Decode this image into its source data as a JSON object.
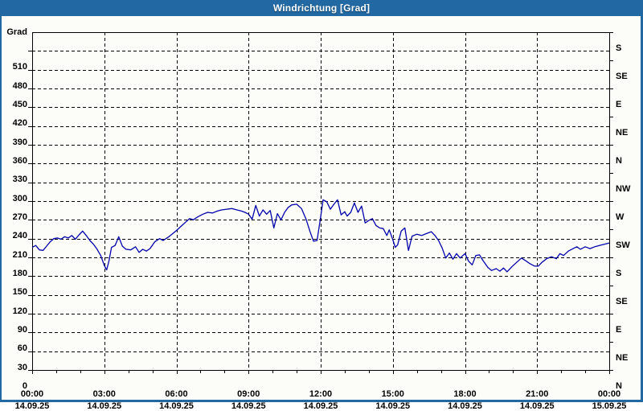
{
  "window": {
    "title": "Windrichtung [Grad]"
  },
  "colors": {
    "titlebar": "#2269a3",
    "window_border": "#2269a3",
    "title_text": "#ffffff",
    "plot_background": "#fcfcf8",
    "axis_color": "#000000",
    "grid_color": "#000000",
    "line_color": "#0000aa",
    "label_color": "#000000"
  },
  "chart_data": {
    "type": "line",
    "title": "Windrichtung [Grad]",
    "ylabel": "Grad",
    "xlabel": "",
    "ylim": [
      0,
      540
    ],
    "xlim_hours": [
      0,
      24
    ],
    "grid": "dashed",
    "legend_position": "none",
    "y_ticks": [
      0,
      30,
      60,
      90,
      120,
      150,
      180,
      210,
      240,
      270,
      300,
      330,
      360,
      390,
      420,
      450,
      480,
      510
    ],
    "y_unit_label": "Grad",
    "right_axis_compass": [
      {
        "deg": 540,
        "label": "S"
      },
      {
        "deg": 495,
        "label": "SE"
      },
      {
        "deg": 450,
        "label": "E"
      },
      {
        "deg": 405,
        "label": "NE"
      },
      {
        "deg": 360,
        "label": "N"
      },
      {
        "deg": 315,
        "label": "NW"
      },
      {
        "deg": 270,
        "label": "W"
      },
      {
        "deg": 225,
        "label": "SW"
      },
      {
        "deg": 180,
        "label": "S"
      },
      {
        "deg": 135,
        "label": "SE"
      },
      {
        "deg": 90,
        "label": "E"
      },
      {
        "deg": 45,
        "label": "NE"
      },
      {
        "deg": 0,
        "label": "N"
      }
    ],
    "x_major_ticks": [
      {
        "hour": 0,
        "time": "00:00",
        "date": "14.09.25"
      },
      {
        "hour": 3,
        "time": "03:00",
        "date": "14.09.25"
      },
      {
        "hour": 6,
        "time": "06:00",
        "date": "14.09.25"
      },
      {
        "hour": 9,
        "time": "09:00",
        "date": "14.09.25"
      },
      {
        "hour": 12,
        "time": "12:00",
        "date": "14.09.25"
      },
      {
        "hour": 15,
        "time": "15:00",
        "date": "14.09.25"
      },
      {
        "hour": 18,
        "time": "18:00",
        "date": "14.09.25"
      },
      {
        "hour": 21,
        "time": "21:00",
        "date": "14.09.25"
      },
      {
        "hour": 24,
        "time": "00:00",
        "date": "15.09.25"
      }
    ],
    "x_minor_tick_every_hours": 1,
    "series": [
      {
        "name": "Windrichtung",
        "color": "#0000aa",
        "points": [
          [
            0,
            196
          ],
          [
            0.15,
            199
          ],
          [
            0.3,
            192
          ],
          [
            0.45,
            191
          ],
          [
            0.6,
            198
          ],
          [
            0.75,
            205
          ],
          [
            0.9,
            210
          ],
          [
            1.05,
            211
          ],
          [
            1.2,
            209
          ],
          [
            1.35,
            213
          ],
          [
            1.5,
            211
          ],
          [
            1.65,
            215
          ],
          [
            1.8,
            209
          ],
          [
            1.95,
            216
          ],
          [
            2.1,
            222
          ],
          [
            2.25,
            215
          ],
          [
            2.4,
            207
          ],
          [
            2.55,
            201
          ],
          [
            2.7,
            193
          ],
          [
            2.85,
            183
          ],
          [
            3.0,
            167
          ],
          [
            3.1,
            160
          ],
          [
            3.2,
            175
          ],
          [
            3.3,
            196
          ],
          [
            3.45,
            199
          ],
          [
            3.6,
            213
          ],
          [
            3.75,
            198
          ],
          [
            3.9,
            193
          ],
          [
            4.1,
            192
          ],
          [
            4.3,
            197
          ],
          [
            4.45,
            188
          ],
          [
            4.6,
            193
          ],
          [
            4.75,
            190
          ],
          [
            4.9,
            194
          ],
          [
            5.1,
            205
          ],
          [
            5.3,
            210
          ],
          [
            5.45,
            207
          ],
          [
            5.65,
            212
          ],
          [
            5.85,
            218
          ],
          [
            6.0,
            223
          ],
          [
            6.2,
            230
          ],
          [
            6.4,
            237
          ],
          [
            6.55,
            242
          ],
          [
            6.7,
            240
          ],
          [
            6.9,
            245
          ],
          [
            7.1,
            249
          ],
          [
            7.3,
            252
          ],
          [
            7.5,
            251
          ],
          [
            7.7,
            254
          ],
          [
            7.9,
            256
          ],
          [
            8.1,
            257
          ],
          [
            8.3,
            258
          ],
          [
            8.5,
            256
          ],
          [
            8.7,
            254
          ],
          [
            8.85,
            252
          ],
          [
            9.0,
            249
          ],
          [
            9.15,
            241
          ],
          [
            9.3,
            263
          ],
          [
            9.45,
            246
          ],
          [
            9.6,
            256
          ],
          [
            9.75,
            249
          ],
          [
            9.9,
            255
          ],
          [
            10.05,
            227
          ],
          [
            10.2,
            250
          ],
          [
            10.35,
            240
          ],
          [
            10.5,
            252
          ],
          [
            10.65,
            260
          ],
          [
            10.8,
            264
          ],
          [
            11.0,
            265
          ],
          [
            11.2,
            258
          ],
          [
            11.4,
            240
          ],
          [
            11.55,
            222
          ],
          [
            11.7,
            206
          ],
          [
            11.85,
            207
          ],
          [
            12.0,
            245
          ],
          [
            12.1,
            272
          ],
          [
            12.25,
            269
          ],
          [
            12.4,
            257
          ],
          [
            12.55,
            265
          ],
          [
            12.7,
            272
          ],
          [
            12.85,
            248
          ],
          [
            13.0,
            253
          ],
          [
            13.1,
            246
          ],
          [
            13.25,
            252
          ],
          [
            13.4,
            267
          ],
          [
            13.55,
            252
          ],
          [
            13.7,
            262
          ],
          [
            13.85,
            235
          ],
          [
            14.0,
            239
          ],
          [
            14.15,
            242
          ],
          [
            14.3,
            231
          ],
          [
            14.45,
            227
          ],
          [
            14.6,
            226
          ],
          [
            14.75,
            215
          ],
          [
            14.85,
            224
          ],
          [
            15.0,
            208
          ],
          [
            15.1,
            196
          ],
          [
            15.2,
            200
          ],
          [
            15.35,
            222
          ],
          [
            15.5,
            227
          ],
          [
            15.65,
            191
          ],
          [
            15.8,
            214
          ],
          [
            16.0,
            217
          ],
          [
            16.2,
            215
          ],
          [
            16.4,
            218
          ],
          [
            16.6,
            221
          ],
          [
            16.75,
            215
          ],
          [
            16.9,
            207
          ],
          [
            17.05,
            195
          ],
          [
            17.2,
            179
          ],
          [
            17.35,
            187
          ],
          [
            17.5,
            177
          ],
          [
            17.65,
            186
          ],
          [
            17.8,
            179
          ],
          [
            18.0,
            186
          ],
          [
            18.15,
            174
          ],
          [
            18.3,
            168
          ],
          [
            18.45,
            183
          ],
          [
            18.6,
            184
          ],
          [
            18.75,
            175
          ],
          [
            18.95,
            164
          ],
          [
            19.1,
            159
          ],
          [
            19.3,
            162
          ],
          [
            19.45,
            158
          ],
          [
            19.6,
            163
          ],
          [
            19.75,
            157
          ],
          [
            19.95,
            165
          ],
          [
            20.15,
            172
          ],
          [
            20.35,
            179
          ],
          [
            20.55,
            174
          ],
          [
            20.7,
            170
          ],
          [
            20.9,
            166
          ],
          [
            21.05,
            166
          ],
          [
            21.2,
            172
          ],
          [
            21.4,
            178
          ],
          [
            21.6,
            181
          ],
          [
            21.8,
            178
          ],
          [
            21.95,
            186
          ],
          [
            22.1,
            183
          ],
          [
            22.3,
            190
          ],
          [
            22.5,
            194
          ],
          [
            22.65,
            197
          ],
          [
            22.8,
            193
          ],
          [
            23.0,
            197
          ],
          [
            23.2,
            194
          ],
          [
            23.4,
            197
          ],
          [
            23.7,
            200
          ],
          [
            24.0,
            203
          ]
        ]
      }
    ]
  }
}
